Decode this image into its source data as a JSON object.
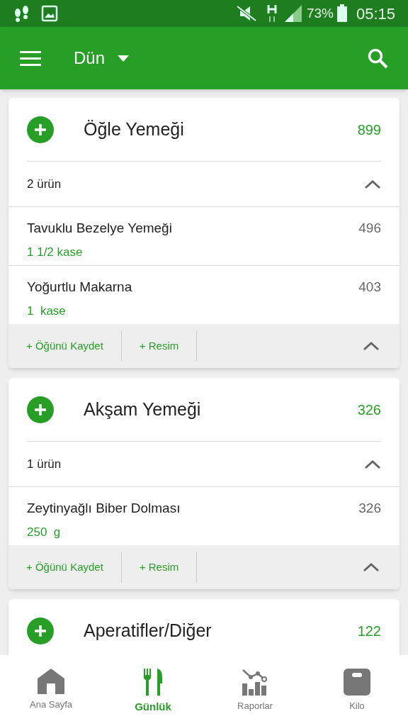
{
  "status_bar": {
    "battery": "73%",
    "time": "05:15"
  },
  "app_bar": {
    "title": "Dün"
  },
  "meals": [
    {
      "name": "Öğle Yemeği",
      "calories": "899",
      "count": "2 ürün",
      "expanded": true,
      "items": [
        {
          "name": "Tavuklu Bezelye Yemeği",
          "amount": "1 1/2 kase",
          "calories": "496"
        },
        {
          "name": "Yoğurtlu Makarna",
          "amount": "1  kase",
          "calories": "403"
        }
      ],
      "actions": [
        "+ Öğünü Kaydet",
        "+ Resim"
      ]
    },
    {
      "name": "Akşam Yemeği",
      "calories": "326",
      "count": "1 ürün",
      "expanded": true,
      "items": [
        {
          "name": "Zeytinyağlı Biber Dolması",
          "amount": "250  g",
          "calories": "326"
        }
      ],
      "actions": [
        "+ Öğünü Kaydet",
        "+ Resim"
      ]
    },
    {
      "name": "Aperatifler/Diğer",
      "calories": "122"
    }
  ],
  "bottom_nav": [
    {
      "kind": "home",
      "label": "Ana Sayfa",
      "selected": false
    },
    {
      "kind": "diary",
      "label": "Günlük",
      "selected": true
    },
    {
      "kind": "reports",
      "label": "Raporlar",
      "selected": false
    },
    {
      "kind": "weight",
      "label": "Kilo",
      "selected": false
    }
  ]
}
